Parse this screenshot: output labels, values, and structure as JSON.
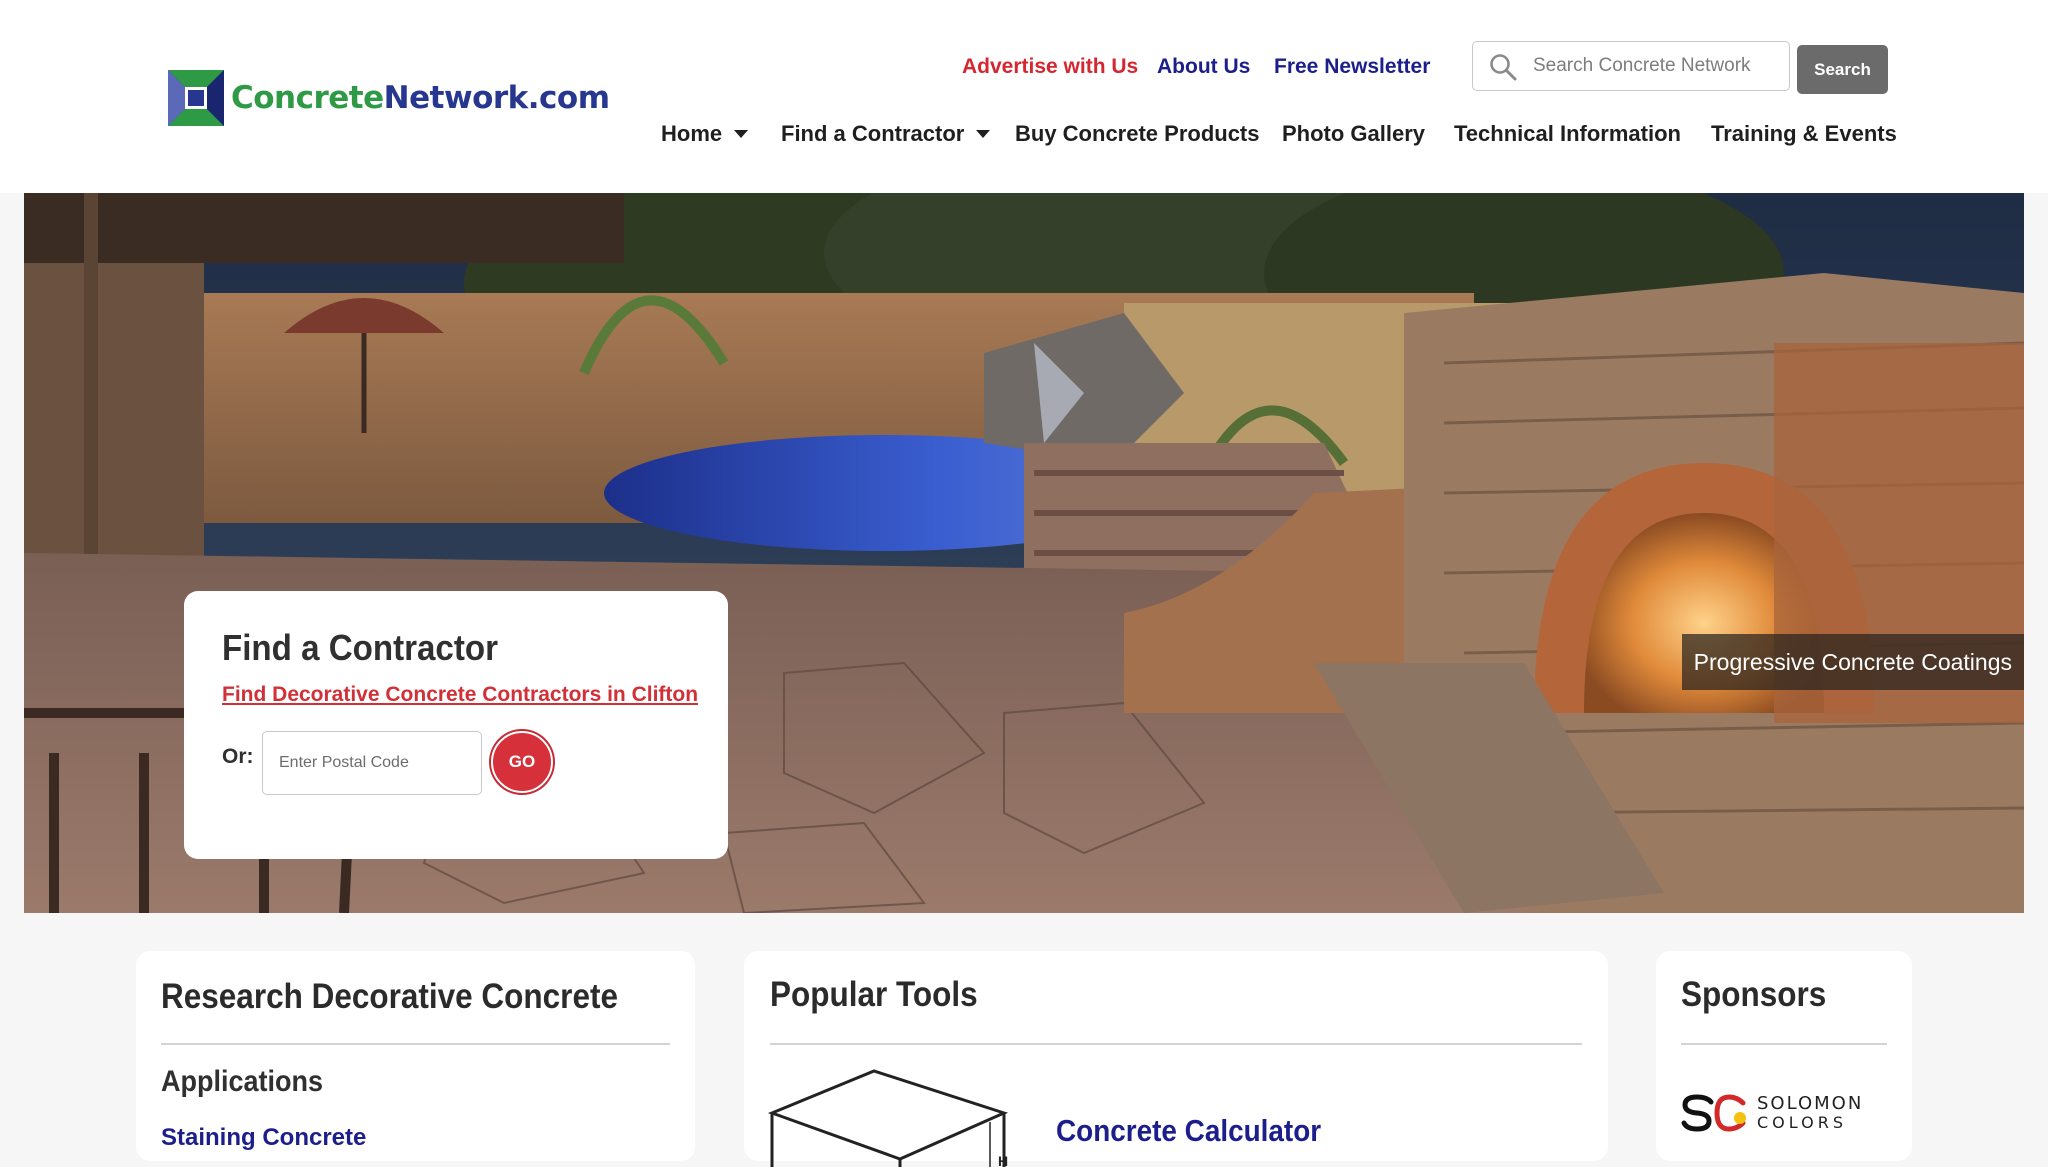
{
  "header": {
    "logo": {
      "text_part1": "Concrete",
      "text_part2": "Network.com"
    },
    "utility_links": [
      {
        "label": "Advertise with Us",
        "color": "#d6262f"
      },
      {
        "label": "About Us",
        "color": "#1c1f8b"
      },
      {
        "label": "Free Newsletter",
        "color": "#1c1f8b"
      }
    ],
    "search": {
      "placeholder": "Search Concrete Network",
      "button_label": "Search"
    },
    "nav": [
      {
        "label": "Home",
        "has_dropdown": true
      },
      {
        "label": "Find a Contractor",
        "has_dropdown": true
      },
      {
        "label": "Buy Concrete Products",
        "has_dropdown": false
      },
      {
        "label": "Photo Gallery",
        "has_dropdown": false
      },
      {
        "label": "Technical Information",
        "has_dropdown": false
      },
      {
        "label": "Training & Events",
        "has_dropdown": false
      }
    ]
  },
  "hero": {
    "caption": "Progressive Concrete Coatings",
    "find_contractor": {
      "title": "Find a Contractor",
      "link_text": "Find Decorative Concrete Contractors in Clifton",
      "or_label": "Or:",
      "postal_placeholder": "Enter Postal Code",
      "go_label": "GO"
    }
  },
  "research": {
    "title": "Research Decorative Concrete",
    "section": "Applications",
    "links": [
      "Staining Concrete"
    ]
  },
  "tools": {
    "title": "Popular Tools",
    "items": [
      {
        "label": "Concrete Calculator",
        "diagram_label": "H"
      }
    ]
  },
  "sponsors": {
    "title": "Sponsors",
    "logos": [
      {
        "line1": "SOLOMON",
        "line2": "COLORS"
      }
    ]
  },
  "colors": {
    "brand_blue": "#1c1f8b",
    "brand_red": "#d6262f",
    "logo_green": "#2e9a45",
    "search_button": "#6b6b6b"
  }
}
